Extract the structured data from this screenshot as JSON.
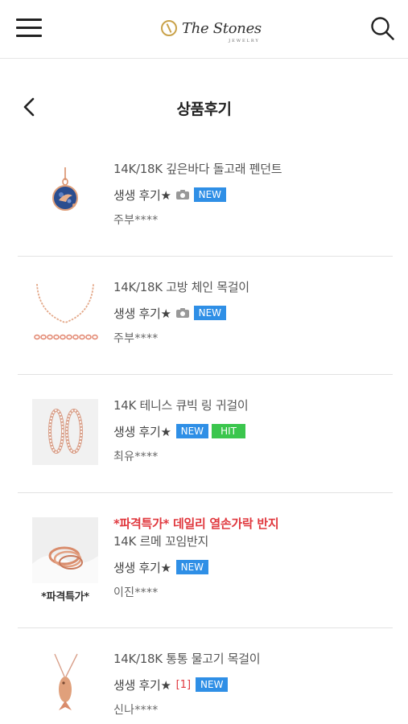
{
  "header": {
    "brand": "The Stones",
    "brand_sub": "JEWELRY",
    "menu_icon": "hamburger-menu-icon",
    "search_icon": "search-icon"
  },
  "page": {
    "title": "상품후기",
    "back_icon": "chevron-left-icon"
  },
  "colors": {
    "accent_gold": "#c9a24a",
    "badge_new": "#2f8fe6",
    "badge_hit": "#3bc64d",
    "promo_red": "#e0383e"
  },
  "reviews": [
    {
      "product": "14K/18K 깊은바다 돌고래 펜던트",
      "title": "생생 후기★",
      "has_photo": true,
      "badges": [
        "NEW"
      ],
      "author": "주부****"
    },
    {
      "product": "14K/18K 고방 체인 목걸이",
      "title": "생생 후기★",
      "has_photo": true,
      "badges": [
        "NEW"
      ],
      "author": "주부****"
    },
    {
      "product": "14K 테니스 큐빅 링 귀걸이",
      "title": "생생 후기★",
      "has_photo": false,
      "badges": [
        "NEW",
        "HIT"
      ],
      "author": "최유****"
    },
    {
      "promo": "*파격특가* 데일리 열손가락 반지",
      "product": "14K 르메 꼬임반지",
      "title": "생생 후기★",
      "has_photo": false,
      "badges": [
        "NEW"
      ],
      "author": "이진****",
      "thumb_caption": "*파격특가*"
    },
    {
      "product": "14K/18K 통통 물고기 목걸이",
      "title": "생생 후기★",
      "comment_count": "[1]",
      "badges": [
        "NEW"
      ],
      "author": "신나****"
    }
  ]
}
